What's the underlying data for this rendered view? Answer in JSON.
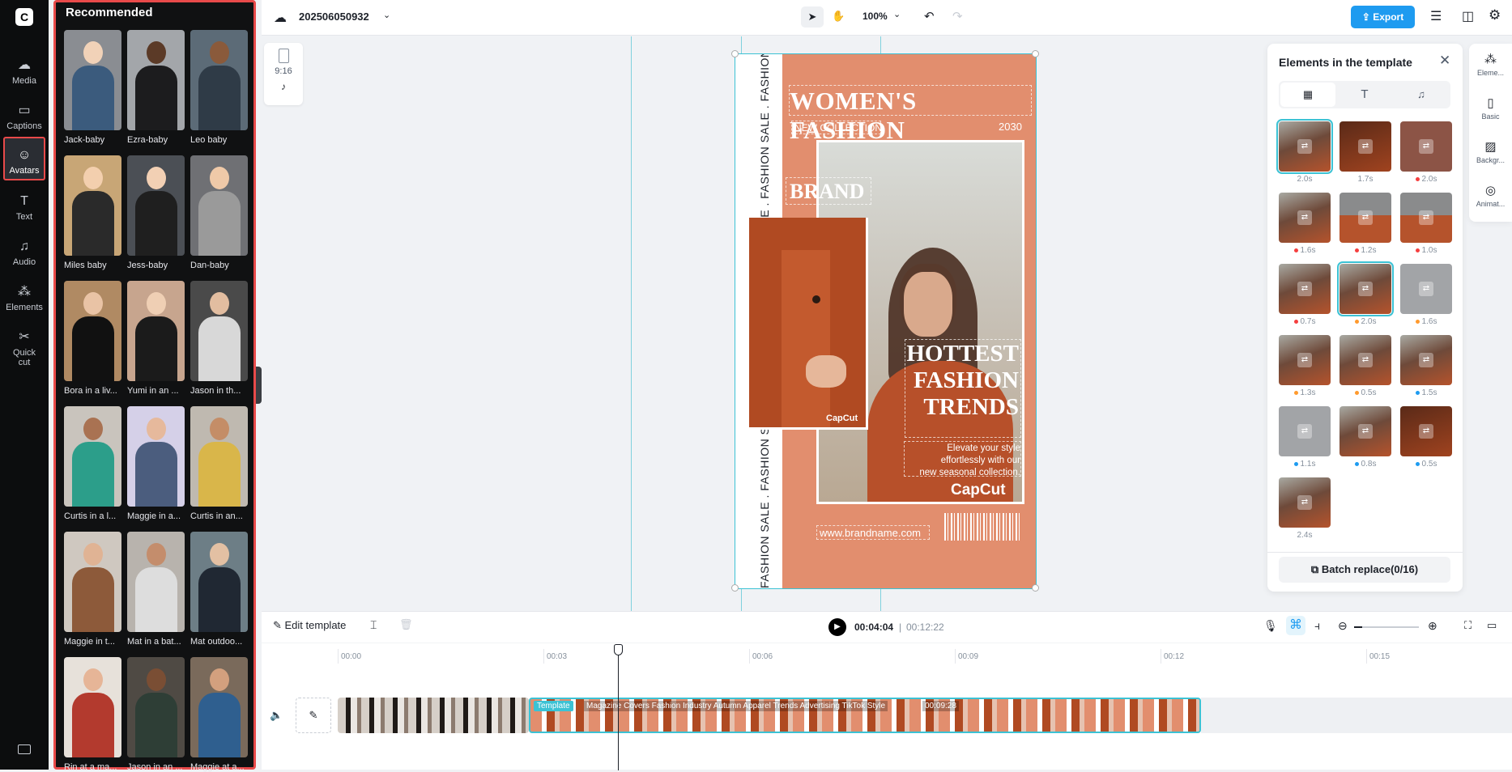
{
  "nav": {
    "items": [
      {
        "label": "Media",
        "icon": "cloud-upload-icon"
      },
      {
        "label": "Captions",
        "icon": "captions-icon"
      },
      {
        "label": "Avatars",
        "icon": "avatar-icon"
      },
      {
        "label": "Text",
        "icon": "text-icon"
      },
      {
        "label": "Audio",
        "icon": "music-icon"
      },
      {
        "label": "Elements",
        "icon": "elements-icon"
      },
      {
        "label": "Quick cut",
        "icon": "quick-cut-icon"
      }
    ]
  },
  "panel": {
    "title": "Recommended",
    "avatars": [
      {
        "label": "Jack-baby"
      },
      {
        "label": "Ezra-baby"
      },
      {
        "label": "Leo baby"
      },
      {
        "label": "Miles baby"
      },
      {
        "label": "Jess-baby"
      },
      {
        "label": "Dan-baby"
      },
      {
        "label": "Bora in a liv..."
      },
      {
        "label": "Yumi in an ..."
      },
      {
        "label": "Jason in th..."
      },
      {
        "label": "Curtis in a l..."
      },
      {
        "label": "Maggie in a..."
      },
      {
        "label": "Curtis in an..."
      },
      {
        "label": "Maggie in t..."
      },
      {
        "label": "Mat in a bat..."
      },
      {
        "label": "Mat outdoo..."
      },
      {
        "label": "Rin at a ma..."
      },
      {
        "label": "Jason in an ..."
      },
      {
        "label": "Maggie at a..."
      }
    ]
  },
  "topbar": {
    "project_name": "202506050932",
    "zoom": "100%",
    "export_label": "Export"
  },
  "ratio": {
    "label": "9:16"
  },
  "poster": {
    "side_text": "FASHION SALE . FASHION SALE . FASHION SALE . FASHION SALE . FASHION SALE . FASHION S",
    "title": "WOMEN'S FASHION",
    "subtitle": "NEW COLLECTION",
    "year": "2030",
    "brand": "BRAND",
    "headline_1": "HOTTEST",
    "headline_2": "FASHION",
    "headline_3": "TRENDS",
    "body_1": "Elevate your style",
    "body_2": "effortlessly with our",
    "body_3": "new seasonal collection.",
    "watermark": "CapCut",
    "url": "www.brandname.com"
  },
  "elements_panel": {
    "title": "Elements in the template",
    "thumbs": [
      {
        "duration": "2.0s",
        "dot": "",
        "selected": true,
        "tone": "photo"
      },
      {
        "duration": "1.7s",
        "dot": "",
        "selected": false,
        "tone": "dark"
      },
      {
        "duration": "2.0s",
        "dot": "#f53f3f",
        "selected": false,
        "tone": "brown"
      },
      {
        "duration": "1.6s",
        "dot": "#f53f3f",
        "selected": false,
        "tone": "photo"
      },
      {
        "duration": "1.2s",
        "dot": "#f53f3f",
        "selected": false,
        "tone": "half"
      },
      {
        "duration": "1.0s",
        "dot": "#f53f3f",
        "selected": false,
        "tone": "half"
      },
      {
        "duration": "0.7s",
        "dot": "#f53f3f",
        "selected": false,
        "tone": "photo"
      },
      {
        "duration": "2.0s",
        "dot": "#ff9a2e",
        "selected": true,
        "tone": "photo"
      },
      {
        "duration": "1.6s",
        "dot": "#ff9a2e",
        "selected": false,
        "tone": "grey"
      },
      {
        "duration": "1.3s",
        "dot": "#ff9a2e",
        "selected": false,
        "tone": "photo"
      },
      {
        "duration": "0.5s",
        "dot": "#ff9a2e",
        "selected": false,
        "tone": "photo"
      },
      {
        "duration": "1.5s",
        "dot": "#1e9bf0",
        "selected": false,
        "tone": "photo"
      },
      {
        "duration": "1.1s",
        "dot": "#1e9bf0",
        "selected": false,
        "tone": "grey"
      },
      {
        "duration": "0.8s",
        "dot": "#1e9bf0",
        "selected": false,
        "tone": "photo"
      },
      {
        "duration": "0.5s",
        "dot": "#1e9bf0",
        "selected": false,
        "tone": "dark"
      },
      {
        "duration": "2.4s",
        "dot": "",
        "selected": false,
        "tone": "photo"
      }
    ],
    "batch_label": "Batch replace(0/16)"
  },
  "rightrail": {
    "items": [
      {
        "label": "Eleme...",
        "icon": "elements-icon"
      },
      {
        "label": "Basic",
        "icon": "basic-icon"
      },
      {
        "label": "Backgr...",
        "icon": "background-icon"
      },
      {
        "label": "Animat...",
        "icon": "animation-icon"
      }
    ]
  },
  "timeline": {
    "edit_label": "Edit template",
    "current_time": "00:04:04",
    "total_time": "00:12:22",
    "ticks": [
      "00:00",
      "00:03",
      "00:06",
      "00:09",
      "00:12",
      "00:15"
    ],
    "template_badge": "Template",
    "template_title": "Magazine Covers Fashion Industry Autumn Apparel Trends Advertising TikTok Style",
    "template_duration": "00:09:28"
  },
  "colors": {
    "accent": "#1e9bf0",
    "export_bg": "#1e9bf0",
    "highlight_red": "#e84a4a",
    "poster_bg": "#e28e6e",
    "selection_cyan": "#3cc2d4"
  }
}
